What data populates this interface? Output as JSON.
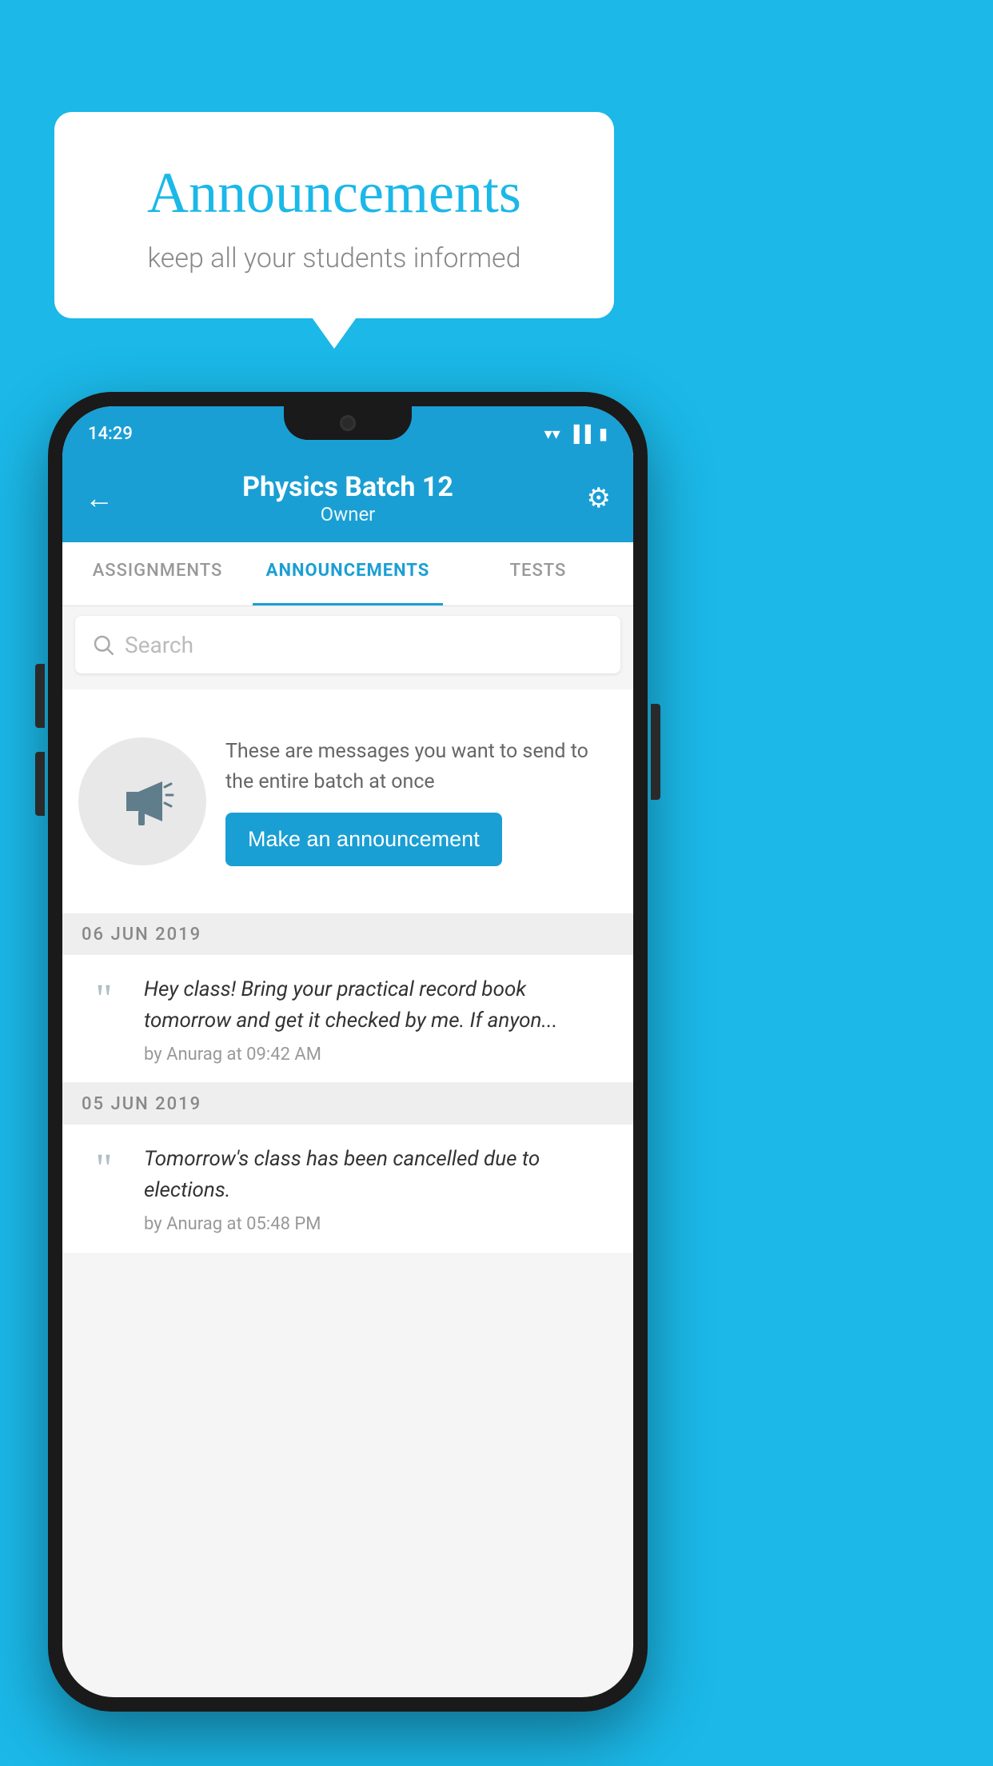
{
  "page": {
    "background_color": "#1bb8e8"
  },
  "speech_bubble": {
    "title": "Announcements",
    "subtitle": "keep all your students informed"
  },
  "status_bar": {
    "time": "14:29",
    "wifi_icon": "▼",
    "signal_icon": "◀",
    "battery_icon": "▮"
  },
  "header": {
    "back_icon": "←",
    "title": "Physics Batch 12",
    "subtitle": "Owner",
    "gear_icon": "⚙"
  },
  "tabs": [
    {
      "label": "ASSIGNMENTS",
      "active": false
    },
    {
      "label": "ANNOUNCEMENTS",
      "active": true
    },
    {
      "label": "TESTS",
      "active": false
    },
    {
      "label": "",
      "active": false
    }
  ],
  "search": {
    "placeholder": "Search"
  },
  "promo": {
    "text": "These are messages you want to send to the entire batch at once",
    "button_label": "Make an announcement"
  },
  "date_separators": [
    {
      "date": "06  JUN  2019"
    },
    {
      "date": "05  JUN  2019"
    }
  ],
  "announcements": [
    {
      "message": "Hey class! Bring your practical record book tomorrow and get it checked by me. If anyon...",
      "meta": "by Anurag at 09:42 AM"
    },
    {
      "message": "Tomorrow's class has been cancelled due to elections.",
      "meta": "by Anurag at 05:48 PM"
    }
  ]
}
